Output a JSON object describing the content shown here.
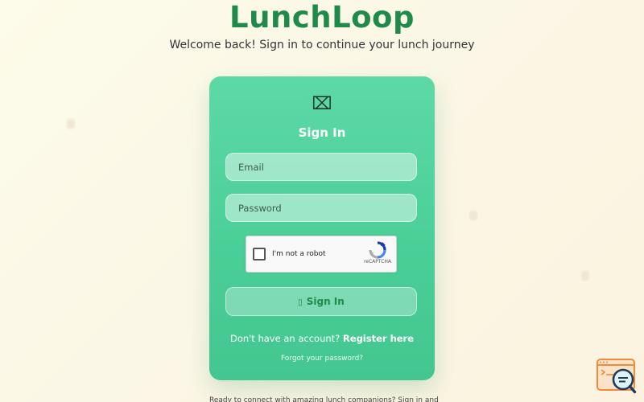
{
  "header": {
    "brand": "LunchLoop",
    "subtitle": "Welcome back! Sign in to continue your lunch journey"
  },
  "card": {
    "icon": "lunch-icon",
    "icon_glyph": "⌧",
    "title": "Sign In",
    "email_placeholder": "Email",
    "password_placeholder": "Password",
    "recaptcha_label": "I'm not a robot",
    "recaptcha_brand": "reCAPTCHA",
    "signin_icon": "login-icon",
    "signin_icon_glyph": "▯",
    "signin_label": "Sign In",
    "register_prompt": "Don't have an account?",
    "register_link": "Register here",
    "forgot": "Forgot your password?"
  },
  "footer": {
    "text": "Ready to connect with amazing lunch companions? Sign in and"
  },
  "widget": {
    "icon": "search-chat-widget-icon"
  },
  "colors": {
    "brand": "#1f8a4a",
    "card": "#4fd39c",
    "background": "#fcf8e6"
  }
}
